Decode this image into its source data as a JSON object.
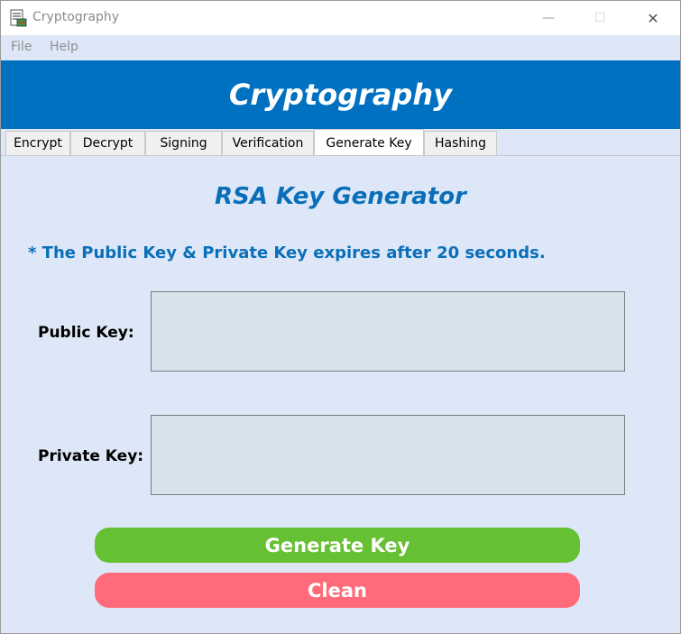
{
  "window": {
    "title": "Cryptography",
    "minimize_glyph": "—",
    "maximize_glyph": "☐",
    "close_glyph": "✕"
  },
  "menu": {
    "items": [
      {
        "label": "File"
      },
      {
        "label": "Help"
      }
    ]
  },
  "banner": {
    "title": "Cryptography",
    "color": "#0070c0"
  },
  "tabs": [
    {
      "label": "Encrypt",
      "active": false
    },
    {
      "label": "Decrypt",
      "active": false
    },
    {
      "label": "Signing",
      "active": false
    },
    {
      "label": "Verification",
      "active": false
    },
    {
      "label": "Generate Key",
      "active": true
    },
    {
      "label": "Hashing",
      "active": false
    }
  ],
  "main": {
    "section_title": "RSA Key Generator",
    "note": "* The Public Key & Private Key expires after 20 seconds.",
    "public_key_label": "Public Key:",
    "public_key_value": "",
    "private_key_label": "Private Key:",
    "private_key_value": "",
    "generate_button": "Generate Key",
    "clean_button": "Clean"
  },
  "colors": {
    "accent_text": "#0a6fb8",
    "content_bg": "#dde7f7",
    "generate_button": "#66c033",
    "clean_button": "#ff6b7b",
    "key_box_bg": "#d6e3ec"
  },
  "icons": {
    "app": "app-icon",
    "minimize": "minimize-icon",
    "maximize": "maximize-icon",
    "close": "close-icon"
  }
}
